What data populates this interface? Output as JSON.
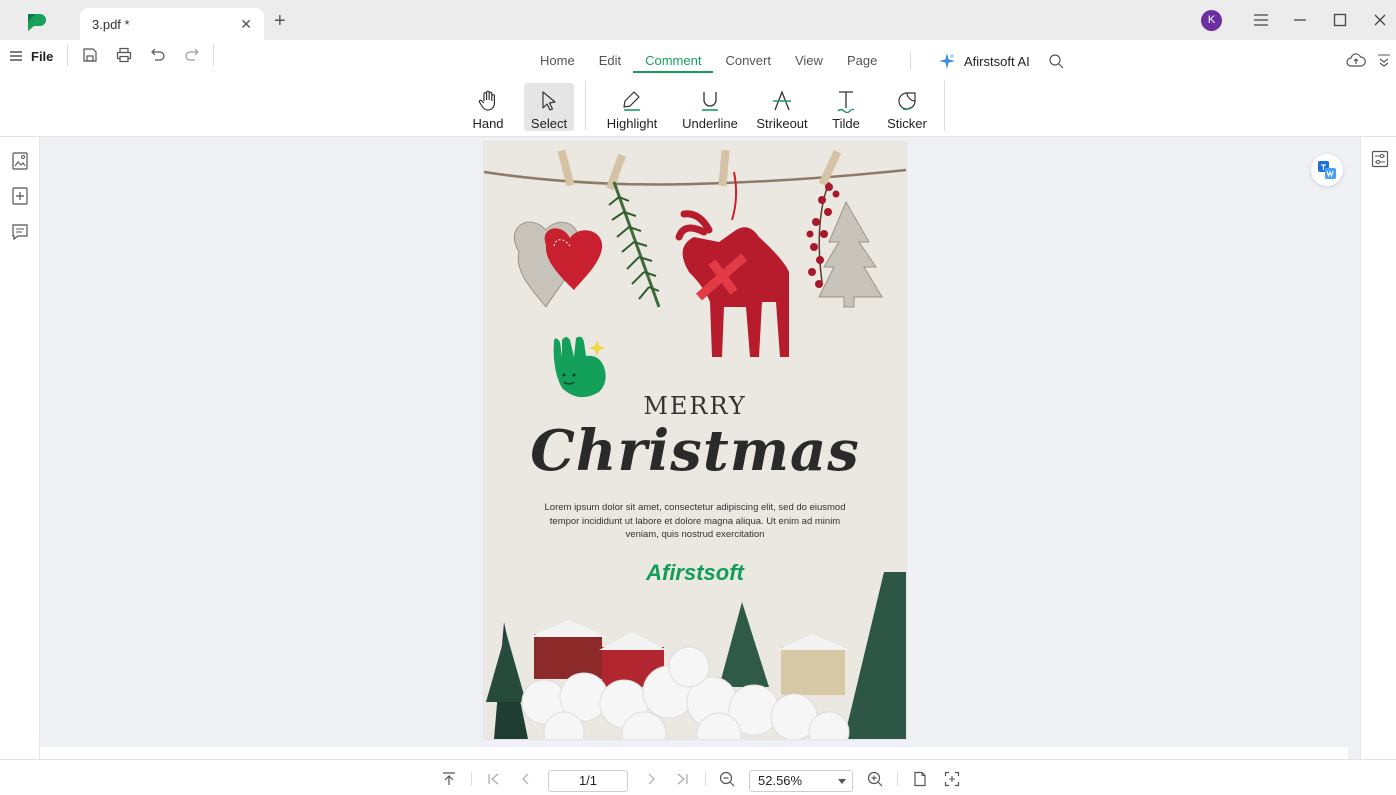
{
  "titlebar": {
    "tab_title": "3.pdf *",
    "avatar_initial": "K",
    "colors": {
      "avatar": "#6b2fa3",
      "brand": "#1a9d5c"
    }
  },
  "menubar": {
    "file_label": "File",
    "tabs": [
      {
        "label": "Home",
        "active": false
      },
      {
        "label": "Edit",
        "active": false
      },
      {
        "label": "Comment",
        "active": true
      },
      {
        "label": "Convert",
        "active": false
      },
      {
        "label": "View",
        "active": false
      },
      {
        "label": "Page",
        "active": false
      }
    ],
    "ai_label": "Afirstsoft AI"
  },
  "tools": [
    {
      "label": "Hand",
      "icon": "hand-icon",
      "active": false
    },
    {
      "label": "Select",
      "icon": "cursor-icon",
      "active": true
    },
    {
      "label": "Highlight",
      "icon": "highlight-pen-icon",
      "active": false
    },
    {
      "label": "Underline",
      "icon": "underline-icon",
      "active": false
    },
    {
      "label": "Strikeout",
      "icon": "strikeout-icon",
      "active": false
    },
    {
      "label": "Tilde",
      "icon": "tilde-text-icon",
      "active": false
    },
    {
      "label": "Sticker",
      "icon": "sticker-icon",
      "active": false
    }
  ],
  "document": {
    "merry": "MERRY",
    "christmas": "Christmas",
    "lorem": "Lorem ipsum dolor sit amet, consectetur adipiscing elit, sed do eiusmod tempor incididunt ut labore et dolore magna aliqua. Ut enim ad minim veniam, quis nostrud exercitation",
    "brand": "Afirstsoft"
  },
  "statusbar": {
    "page_indicator": "1/1",
    "zoom": "52.56%"
  }
}
